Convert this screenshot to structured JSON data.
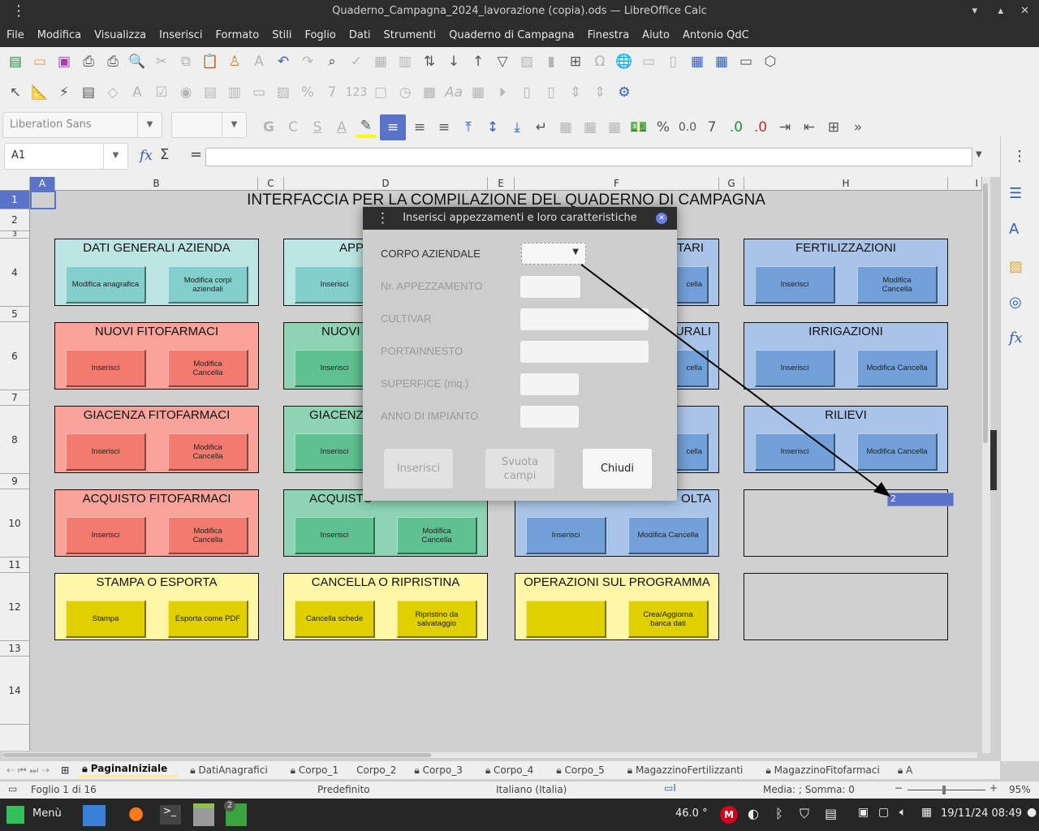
{
  "window": {
    "title": "Quaderno_Campagna_2024_lavorazione (copia).ods — LibreOffice Calc"
  },
  "menu": [
    "File",
    "Modifica",
    "Visualizza",
    "Inserisci",
    "Formato",
    "Stili",
    "Foglio",
    "Dati",
    "Strumenti",
    "Quaderno di Campagna",
    "Finestra",
    "Aiuto",
    "Antonio QdC"
  ],
  "toolbar": {
    "font_name": "Liberation Sans",
    "font_size": "",
    "bold": "G",
    "italic": "C",
    "underline": "S",
    "percent": "%",
    "decimal": "0.0",
    "num123": "123",
    "aa": "Aa"
  },
  "formula": {
    "name_box": "A1",
    "fx": "fx",
    "sum": "Σ",
    "eq": "=",
    "content": ""
  },
  "columns": [
    "A",
    "B",
    "C",
    "D",
    "E",
    "F",
    "G",
    "H",
    "I"
  ],
  "rows": [
    "1",
    "2",
    "3",
    "4",
    "5",
    "6",
    "7",
    "8",
    "9",
    "10",
    "11",
    "12",
    "13",
    "14"
  ],
  "sheet": {
    "title": "INTERFACCIA PER LA COMPILAZIONE DEL QUADERNO DI CAMPAGNA",
    "selected_cell_value": "2"
  },
  "blocks": {
    "dati_generali": {
      "title": "DATI GENERALI AZIENDA",
      "b1": "Modifica anagrafica",
      "b2": "Modifica corpi aziendali"
    },
    "app": {
      "title": "APP",
      "b1": "Inserisci"
    },
    "tari": {
      "title": "TARI",
      "b2": "cella"
    },
    "fertilizzazioni": {
      "title": "FERTILIZZAZIONI",
      "b1": "Inserisci",
      "b2": "Modifica Cancella"
    },
    "nuovi_fitofarmaci": {
      "title": "NUOVI FITOFARMACI",
      "b1": "Inserisci",
      "b2": "Modifica Cancella"
    },
    "nuovi": {
      "title": "NUOVI",
      "b1": "Inserisci"
    },
    "urali": {
      "title": "URALI",
      "b2": "cella"
    },
    "irrigazioni": {
      "title": "IRRIGAZIONI",
      "b1": "Inserisci",
      "b2": "Modifica Cancella"
    },
    "giacenza_fitofarmaci": {
      "title": "GIACENZA FITOFARMACI",
      "b1": "Inserisci",
      "b2": "Modifica Cancella"
    },
    "giacenz": {
      "title": "GIACENZ",
      "b1": "Inserisci"
    },
    "f8": {
      "b2": "cella"
    },
    "rilievi": {
      "title": "RILIEVI",
      "b1": "Inserisci",
      "b2": "Modifica  Cancella"
    },
    "acquisto_fitofarmaci": {
      "title": "ACQUISTO FITOFARMACI",
      "b1": "Inserisci",
      "b2": "Modifica Cancella"
    },
    "acquisto_fert": {
      "title": "ACQUISTO",
      "b1": "Inserisci",
      "b2": "Modifica Cancella"
    },
    "raccolta": {
      "title": "OLTA",
      "b1": "Inserisci",
      "b2": "Modifica  Cancella"
    },
    "stampa": {
      "title": "STAMPA O ESPORTA",
      "b1": "Stampa",
      "b2": "Esporta come PDF"
    },
    "cancella": {
      "title": "CANCELLA O RIPRISTINA",
      "b1": "Cancella schede",
      "b2": "Ripristino da salvataggio"
    },
    "operazioni": {
      "title": "OPERAZIONI SUL PROGRAMMA",
      "b1": "",
      "b2": "Crea/Aggiorna banca dati"
    }
  },
  "dialog": {
    "title": "Inserisci appezzamenti e loro caratteristiche",
    "labels": {
      "corpo": "CORPO AZIENDALE",
      "nr": "Nr. APPEZZAMENTO",
      "cultivar": "CULTIVAR",
      "portainnesto": "PORTAINNESTO",
      "superficie": "SUPERFICE (mq.)",
      "anno": "ANNO DI IMPIANTO"
    },
    "values": {
      "corpo": "",
      "nr": "",
      "cultivar": "",
      "portainnesto": "",
      "superficie": "",
      "anno": ""
    },
    "buttons": {
      "inserisci": "Inserisci",
      "svuota": "Svuota campi",
      "chiudi": "Chiudi"
    }
  },
  "sheet_tabs": [
    "PaginaIniziale",
    "DatiAnagrafici",
    "Corpo_1",
    "Corpo_2",
    "Corpo_3",
    "Corpo_4",
    "Corpo_5",
    "MagazzinoFertilizzanti",
    "MagazzinoFitofarmaci",
    "A"
  ],
  "active_tab": "PaginaIniziale",
  "status": {
    "sheet": "Foglio 1 di 16",
    "style": "Predefinito",
    "language": "Italiano (Italia)",
    "sum": "Media: ; Somma: 0",
    "zoom": "95%",
    "zoom_percent": 95
  },
  "taskbar": {
    "menu": "Menù",
    "temp": "46.0 °",
    "datetime": "19/11/24  08:49",
    "badge": "2"
  },
  "colors": {
    "accent": "#5a72c8",
    "teal": "#bde5e3",
    "red": "#f9a39a",
    "green": "#8dd3b4",
    "blue": "#a9c4e8",
    "yellow": "#fff6a8"
  }
}
